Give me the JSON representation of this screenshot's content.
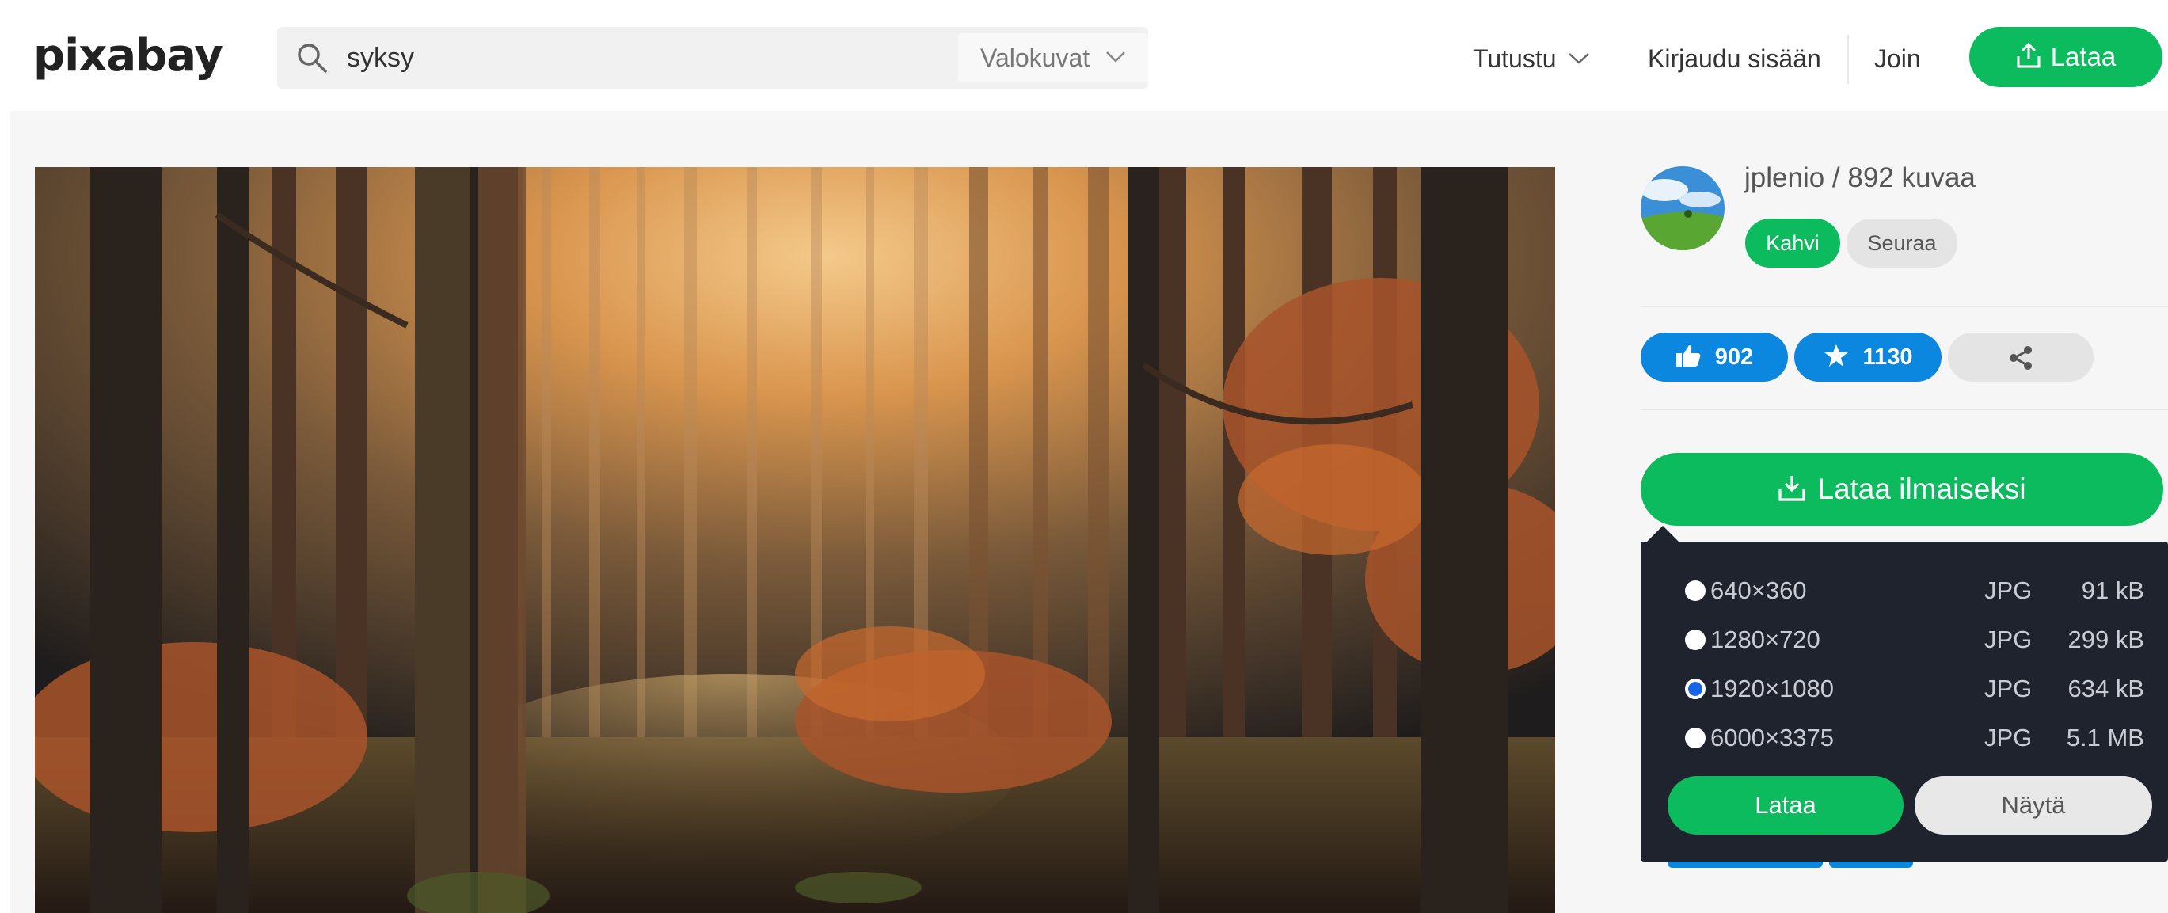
{
  "header": {
    "logo": "pixabay",
    "search_query": "syksy",
    "search_type": "Valokuvat",
    "nav_explore": "Tutustu",
    "nav_login": "Kirjaudu sisään",
    "nav_join": "Join",
    "upload_label": "Lataa"
  },
  "author": {
    "name_line": "jplenio / 892 kuvaa",
    "coffee_label": "Kahvi",
    "follow_label": "Seuraa"
  },
  "stats": {
    "likes": "902",
    "favorites": "1130"
  },
  "download": {
    "main_label": "Lataa ilmaiseksi",
    "options": [
      {
        "resolution": "640×360",
        "format": "JPG",
        "size": "91 kB",
        "selected": false
      },
      {
        "resolution": "1280×720",
        "format": "JPG",
        "size": "299 kB",
        "selected": false
      },
      {
        "resolution": "1920×1080",
        "format": "JPG",
        "size": "634 kB",
        "selected": true
      },
      {
        "resolution": "6000×3375",
        "format": "JPG",
        "size": "5.1 MB",
        "selected": false
      }
    ],
    "download_button": "Lataa",
    "view_button": "Näytä"
  },
  "colors": {
    "brand_green": "#0cbb5d",
    "action_blue": "#0b87e0",
    "dropdown_bg": "#1e232d"
  },
  "icons": {
    "search": "magnifier-icon",
    "upload": "upload-icon",
    "like": "thumbs-up-icon",
    "favorite": "star-icon",
    "share": "share-icon",
    "download": "download-icon"
  }
}
